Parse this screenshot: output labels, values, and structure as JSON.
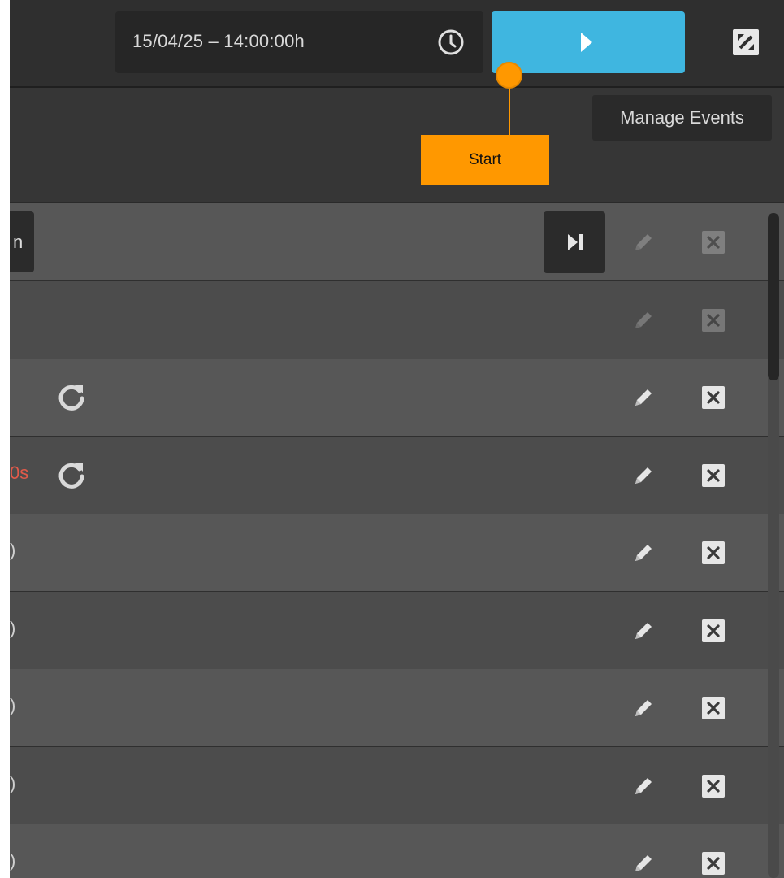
{
  "topbar": {
    "datetime": "15/04/25 – 14:00:00h",
    "clock_icon": "clock-icon",
    "start_button_icon": "play-icon",
    "fullscreen_icon": "fullscreen-icon"
  },
  "subheader": {
    "manage_events_label": "Manage Events"
  },
  "tooltip": {
    "label": "Start",
    "color": "#ff9800"
  },
  "rows": [
    {
      "left_text": "n",
      "left_kind": "button",
      "has_reload": false,
      "has_skip": true,
      "actions_dimmed": true
    },
    {
      "left_text": "",
      "left_kind": "none",
      "has_reload": false,
      "has_skip": false,
      "actions_dimmed": true
    },
    {
      "left_text": "",
      "left_kind": "none",
      "has_reload": true,
      "has_skip": false,
      "actions_dimmed": false
    },
    {
      "left_text": "0s",
      "left_kind": "red",
      "has_reload": true,
      "has_skip": false,
      "actions_dimmed": false
    },
    {
      "left_text": ")",
      "left_kind": "grey",
      "has_reload": false,
      "has_skip": false,
      "actions_dimmed": false
    },
    {
      "left_text": ")",
      "left_kind": "grey",
      "has_reload": false,
      "has_skip": false,
      "actions_dimmed": false
    },
    {
      "left_text": ")",
      "left_kind": "grey",
      "has_reload": false,
      "has_skip": false,
      "actions_dimmed": false
    },
    {
      "left_text": ")",
      "left_kind": "grey",
      "has_reload": false,
      "has_skip": false,
      "actions_dimmed": false
    },
    {
      "left_text": ")",
      "left_kind": "grey",
      "has_reload": false,
      "has_skip": false,
      "actions_dimmed": false
    }
  ],
  "colors": {
    "accent": "#3fb6e0",
    "warning_text": "#e25a4a",
    "tooltip": "#ff9800"
  }
}
